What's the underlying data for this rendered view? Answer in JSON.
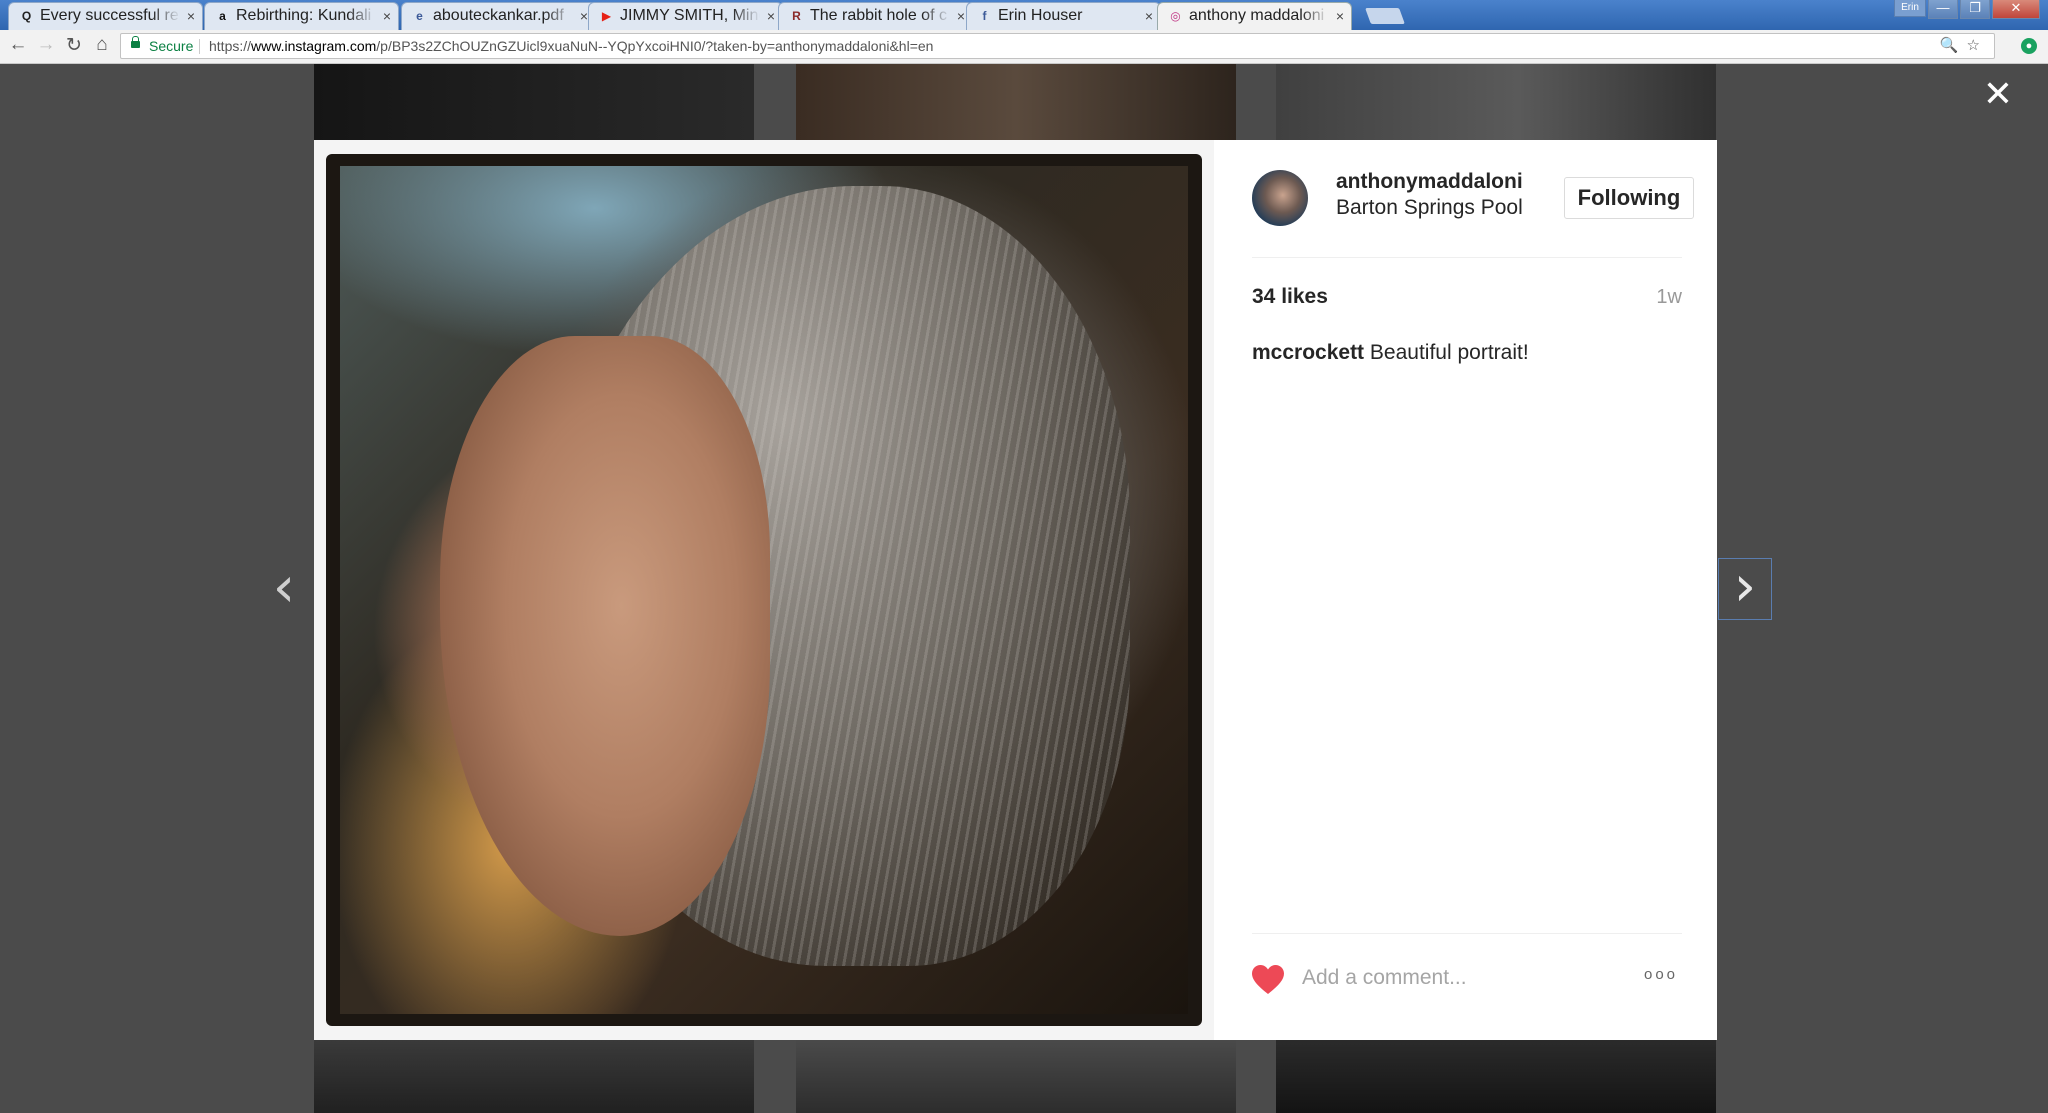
{
  "browser": {
    "tabs": [
      {
        "title": "Every successful rel",
        "favicon": "Q",
        "favicon_color": "#222222",
        "active": false
      },
      {
        "title": "Rebirthing: Kundali",
        "favicon": "a",
        "favicon_color": "#111111",
        "active": false
      },
      {
        "title": "abouteckankar.pdf",
        "favicon": "e",
        "favicon_color": "#3b5998",
        "active": false
      },
      {
        "title": "JIMMY SMITH, Mine",
        "favicon": "▶",
        "favicon_color": "#e62117",
        "active": false
      },
      {
        "title": "The rabbit hole of c",
        "favicon": "R",
        "favicon_color": "#8b2a2a",
        "active": false
      },
      {
        "title": "Erin Houser",
        "favicon": "f",
        "favicon_color": "#3b5998",
        "active": false
      },
      {
        "title": "anthony maddaloni",
        "favicon": "◎",
        "favicon_color": "#c13584",
        "active": true
      }
    ],
    "tab_close": "×",
    "user_badge": "Erin",
    "window_buttons": {
      "minimize": "—",
      "restore": "❐",
      "close": "✕"
    },
    "nav": {
      "back": "←",
      "forward": "→",
      "reload": "↻",
      "home": "⌂"
    },
    "address_bar": {
      "secure_label": "Secure",
      "url_prefix": "https://",
      "url_host": "www.instagram.com",
      "url_path": "/p/BP3s2ZChOUZnGZUicl9xuaNuN--YQpYxcoiHNI0/?taken-by=anthonymaddaloni&hl=en",
      "right_icons": "🔍☆"
    },
    "extension_icon": "●"
  },
  "modal": {
    "close_icon": "✕",
    "prev_arrow": "‹",
    "next_arrow": "›",
    "post": {
      "username": "anthonymaddaloni",
      "location": "Barton Springs Pool",
      "follow_label": "Following",
      "likes": "34 likes",
      "time_ago": "1w",
      "comments": [
        {
          "user": "mccrockett",
          "text": "Beautiful portrait!"
        }
      ],
      "comment_placeholder": "Add a comment...",
      "more_label": "ooo",
      "liked": true,
      "heart_color": "#ed4956"
    }
  }
}
